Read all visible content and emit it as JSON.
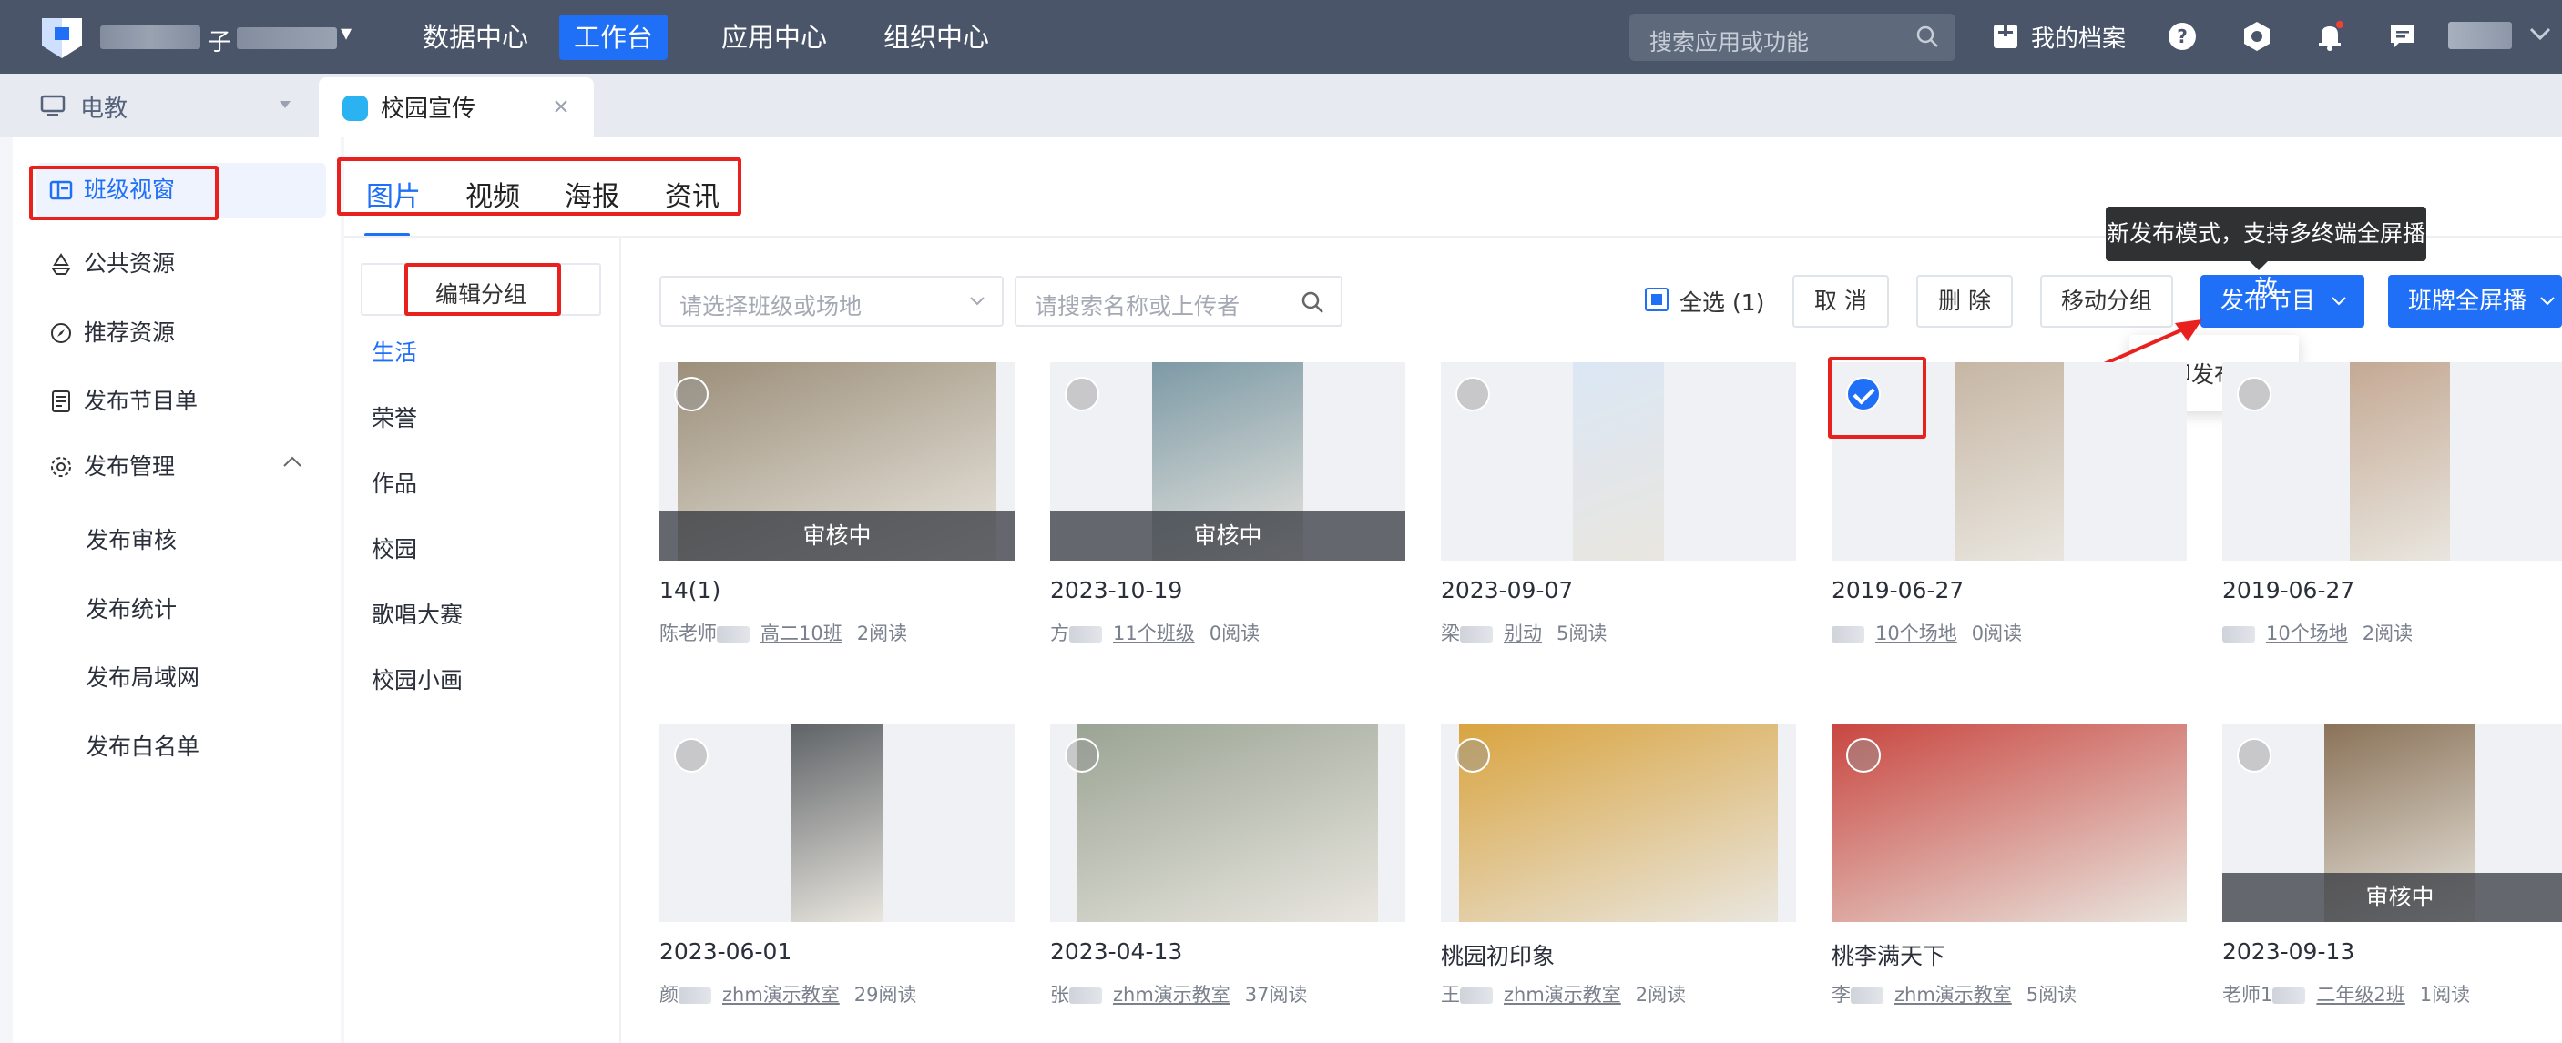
{
  "topbar": {
    "org_char": "子",
    "nav": [
      "数据中心",
      "工作台",
      "应用中心",
      "组织中心"
    ],
    "active_nav": "工作台",
    "search_placeholder": "搜索应用或功能",
    "archive_label": "我的档案"
  },
  "tabs": {
    "first_label": "电教",
    "active_label": "校园宣传"
  },
  "sidebar": {
    "items": [
      {
        "label": "班级视窗",
        "icon": "layout-icon",
        "active": true
      },
      {
        "label": "公共资源",
        "icon": "recycle-icon"
      },
      {
        "label": "推荐资源",
        "icon": "compass-icon"
      },
      {
        "label": "发布节目单",
        "icon": "document-icon"
      },
      {
        "label": "发布管理",
        "icon": "gear-icon"
      }
    ],
    "sub_items": [
      "发布审核",
      "发布统计",
      "发布局域网",
      "发布白名单"
    ]
  },
  "content_tabs": [
    "图片",
    "视频",
    "海报",
    "资讯"
  ],
  "groups": {
    "edit_label": "编辑分组",
    "items": [
      "生活",
      "荣誉",
      "作品",
      "校园",
      "歌唱大赛",
      "校园小画"
    ],
    "active": "生活"
  },
  "toolbar": {
    "select_placeholder": "请选择班级或场地",
    "search_placeholder": "请搜索名称或上传者",
    "select_all_label": "全选 (1)",
    "cancel_label": "取 消",
    "delete_label": "删 除",
    "move_label": "移动分组",
    "publish_label": "发布节目",
    "fullscreen_label": "班牌全屏播",
    "tooltip": "新发布模式，支持多终端全屏播放",
    "dropdown_item": "立即发布节目"
  },
  "status_reviewing": "审核中",
  "cards": [
    {
      "title": "14(1)",
      "author": "陈老师",
      "target": "高二10班",
      "reads": "2阅读",
      "reviewing": true,
      "checked": false,
      "thumb_color": "#9c8f7a"
    },
    {
      "title": "2023-10-19",
      "author": "方",
      "target": "11个班级",
      "reads": "0阅读",
      "reviewing": true,
      "checked": false,
      "thumb_color": "#7d9aa6"
    },
    {
      "title": "2023-09-07",
      "author": "梁",
      "target": "别动",
      "reads": "5阅读",
      "reviewing": false,
      "checked": false,
      "thumb_color": "#dbe7f5"
    },
    {
      "title": "2019-06-27",
      "author": "",
      "target": "10个场地",
      "reads": "0阅读",
      "reviewing": false,
      "checked": true,
      "thumb_color": "#c6b6a4"
    },
    {
      "title": "2019-06-27",
      "author": "",
      "target": "10个场地",
      "reads": "2阅读",
      "reviewing": false,
      "checked": false,
      "thumb_color": "#c4a994"
    },
    {
      "title": "2023-06-01",
      "author": "颜",
      "target": "zhm演示教室",
      "reads": "29阅读",
      "reviewing": false,
      "checked": false,
      "thumb_color": "#5f6367"
    },
    {
      "title": "2023-04-13",
      "author": "张",
      "target": "zhm演示教室",
      "reads": "37阅读",
      "reviewing": false,
      "checked": false,
      "thumb_color": "#9aa494"
    },
    {
      "title": "桃园初印象",
      "author": "王",
      "target": "zhm演示教室",
      "reads": "2阅读",
      "reviewing": false,
      "checked": false,
      "thumb_color": "#d9a440"
    },
    {
      "title": "桃李满天下",
      "author": "李",
      "target": "zhm演示教室",
      "reads": "5阅读",
      "reviewing": false,
      "checked": false,
      "thumb_color": "#c94640"
    },
    {
      "title": "2023-09-13",
      "author": "老师1",
      "target": "二年级2班",
      "reads": "1阅读",
      "reviewing": true,
      "checked": false,
      "thumb_color": "#8a7258"
    }
  ],
  "colors": {
    "brand": "#1f6ff7",
    "annotation_red": "#e8211f",
    "topbar": "#4a5569"
  }
}
